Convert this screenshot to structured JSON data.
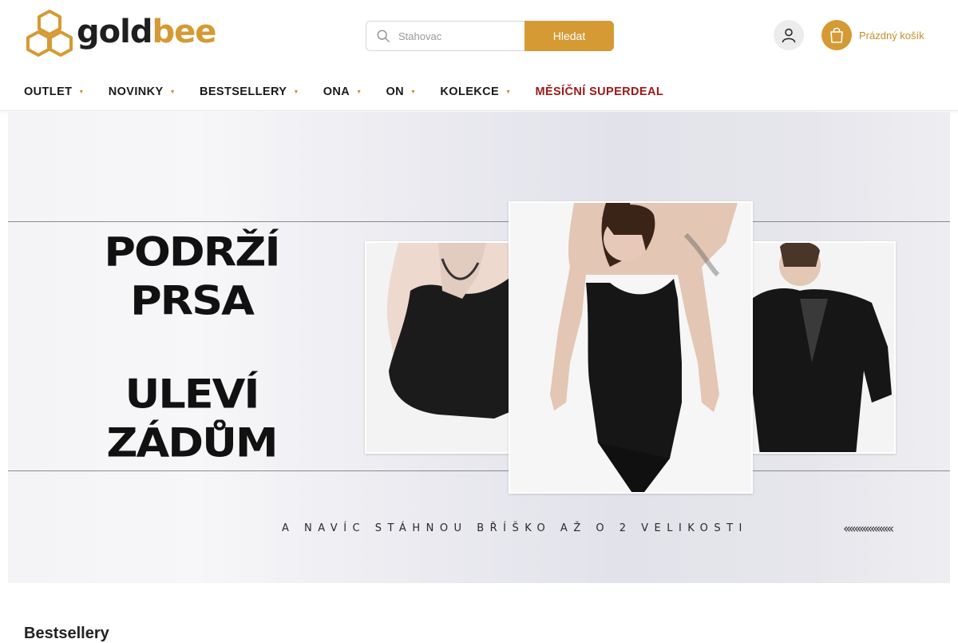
{
  "brand": {
    "part1": "gold",
    "part2": "bee",
    "color_dark": "#1f1f1f",
    "color_gold": "#d59a34"
  },
  "search": {
    "placeholder": "Stahovac",
    "button_label": "Hledat"
  },
  "header": {
    "cart_label": "Prázdný košík"
  },
  "nav": {
    "items": [
      {
        "label": "OUTLET"
      },
      {
        "label": "NOVINKY"
      },
      {
        "label": "BESTSELLERY"
      },
      {
        "label": "ONA"
      },
      {
        "label": "ON"
      },
      {
        "label": "KOLEKCE"
      },
      {
        "label": "MĚSÍČNÍ SUPERDEAL"
      }
    ],
    "deal_color": "#9e1717",
    "caret_icon": "chevron-down-icon"
  },
  "hero": {
    "line1": "PODRŽÍ",
    "line2": "PRSA",
    "line3": "ULEVÍ",
    "line4": "ZÁDŮM",
    "tagline": "A NAVÍC STÁHNOU BŘÍŠKO AŽ O 2 VELIKOSTI",
    "chevrons": "«««««««««"
  },
  "sections": {
    "bestsellers_title": "Bestsellery"
  },
  "colors": {
    "accent": "#d59a34",
    "deal": "#9e1717"
  }
}
